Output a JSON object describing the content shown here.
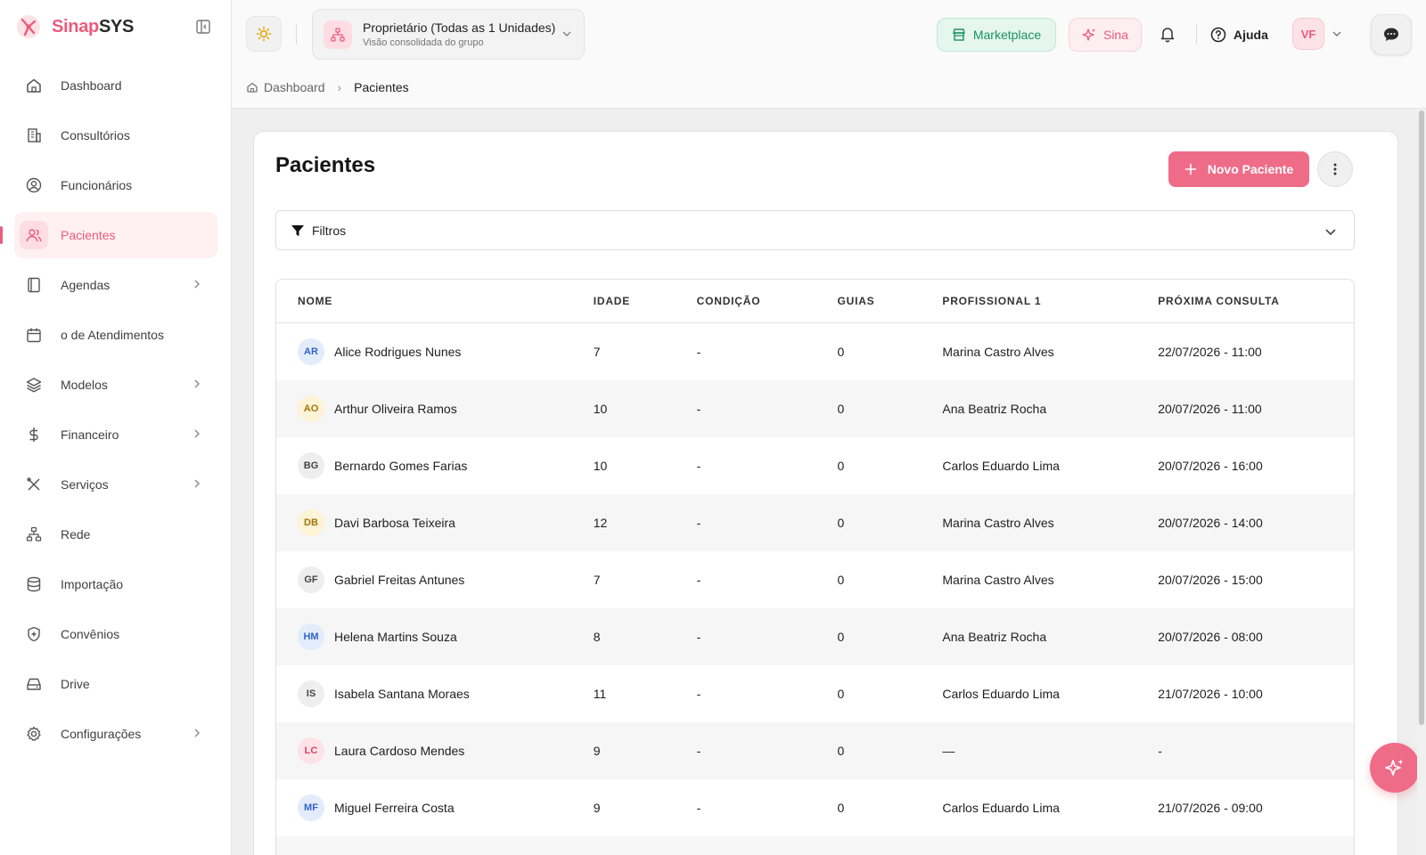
{
  "brand": {
    "name_part1": "Sinap",
    "name_part2": "SYS",
    "accent": "#ec5b7c"
  },
  "sidebar": {
    "items": [
      {
        "label": "Dashboard",
        "icon": "home-icon",
        "has_chevron": false,
        "active": false
      },
      {
        "label": "Consultórios",
        "icon": "building-icon",
        "has_chevron": false,
        "active": false
      },
      {
        "label": "Funcionários",
        "icon": "user-circle-icon",
        "has_chevron": false,
        "active": false
      },
      {
        "label": "Pacientes",
        "icon": "users-icon",
        "has_chevron": false,
        "active": true
      },
      {
        "label": "Agendas",
        "icon": "book-icon",
        "has_chevron": true,
        "active": false
      },
      {
        "label": "o de Atendimentos",
        "icon": "calendar-icon",
        "has_chevron": false,
        "active": false
      },
      {
        "label": "Modelos",
        "icon": "layers-icon",
        "has_chevron": true,
        "active": false
      },
      {
        "label": "Financeiro",
        "icon": "dollar-icon",
        "has_chevron": true,
        "active": false
      },
      {
        "label": "Serviços",
        "icon": "tools-icon",
        "has_chevron": true,
        "active": false
      },
      {
        "label": "Rede",
        "icon": "network-icon",
        "has_chevron": false,
        "active": false
      },
      {
        "label": "Importação",
        "icon": "database-icon",
        "has_chevron": false,
        "active": false
      },
      {
        "label": "Convênios",
        "icon": "shield-icon",
        "has_chevron": false,
        "active": false
      },
      {
        "label": "Drive",
        "icon": "drive-icon",
        "has_chevron": false,
        "active": false
      },
      {
        "label": "Configurações",
        "icon": "gear-icon",
        "has_chevron": true,
        "active": false
      }
    ]
  },
  "header": {
    "unit_title": "Proprietário (Todas as 1 Unidades)",
    "unit_subtitle": "Visão consolidada do grupo",
    "marketplace_label": "Marketplace",
    "sina_label": "Sina",
    "help_label": "Ajuda",
    "avatar_initials": "VF"
  },
  "breadcrumb": {
    "home": "Dashboard",
    "current": "Pacientes"
  },
  "main": {
    "title": "Pacientes",
    "new_button_label": "Novo Paciente",
    "filters_label": "Filtros"
  },
  "table": {
    "columns": [
      "NOME",
      "IDADE",
      "CONDIÇÃO",
      "GUIAS",
      "PROFISSIONAL 1",
      "PRÓXIMA CONSULTA"
    ],
    "rows": [
      {
        "initials": "AR",
        "name": "Alice Rodrigues Nunes",
        "age": "7",
        "condition": "-",
        "guides": "0",
        "professional": "Marina Castro Alves",
        "next": "22/07/2026 - 11:00",
        "av_bg": "#e3ecfb",
        "av_fg": "#3264c8"
      },
      {
        "initials": "AO",
        "name": "Arthur Oliveira Ramos",
        "age": "10",
        "condition": "-",
        "guides": "0",
        "professional": "Ana Beatriz Rocha",
        "next": "20/07/2026 - 11:00",
        "av_bg": "#fdf3d6",
        "av_fg": "#a5740c"
      },
      {
        "initials": "BG",
        "name": "Bernardo Gomes Farias",
        "age": "10",
        "condition": "-",
        "guides": "0",
        "professional": "Carlos Eduardo Lima",
        "next": "20/07/2026 - 16:00",
        "av_bg": "#eeeeee",
        "av_fg": "#444444"
      },
      {
        "initials": "DB",
        "name": "Davi Barbosa Teixeira",
        "age": "12",
        "condition": "-",
        "guides": "0",
        "professional": "Marina Castro Alves",
        "next": "20/07/2026 - 14:00",
        "av_bg": "#fdf3d6",
        "av_fg": "#a5740c"
      },
      {
        "initials": "GF",
        "name": "Gabriel Freitas Antunes",
        "age": "7",
        "condition": "-",
        "guides": "0",
        "professional": "Marina Castro Alves",
        "next": "20/07/2026 - 15:00",
        "av_bg": "#eeeeee",
        "av_fg": "#444444"
      },
      {
        "initials": "HM",
        "name": "Helena Martins Souza",
        "age": "8",
        "condition": "-",
        "guides": "0",
        "professional": "Ana Beatriz Rocha",
        "next": "20/07/2026 - 08:00",
        "av_bg": "#e3ecfb",
        "av_fg": "#3264c8"
      },
      {
        "initials": "IS",
        "name": "Isabela Santana Moraes",
        "age": "11",
        "condition": "-",
        "guides": "0",
        "professional": "Carlos Eduardo Lima",
        "next": "21/07/2026 - 10:00",
        "av_bg": "#eeeeee",
        "av_fg": "#444444"
      },
      {
        "initials": "LC",
        "name": "Laura Cardoso Mendes",
        "age": "9",
        "condition": "-",
        "guides": "0",
        "professional": "—",
        "next": "-",
        "av_bg": "#fde3e8",
        "av_fg": "#d8436a"
      },
      {
        "initials": "MF",
        "name": "Miguel Ferreira Costa",
        "age": "9",
        "condition": "-",
        "guides": "0",
        "professional": "Carlos Eduardo Lima",
        "next": "21/07/2026 - 09:00",
        "av_bg": "#e3ecfb",
        "av_fg": "#3264c8"
      },
      {
        "initials": "",
        "name": "",
        "age": "",
        "condition": "",
        "guides": "",
        "professional": "",
        "next": "",
        "av_bg": "#eeeeee",
        "av_fg": "#444444"
      }
    ]
  }
}
